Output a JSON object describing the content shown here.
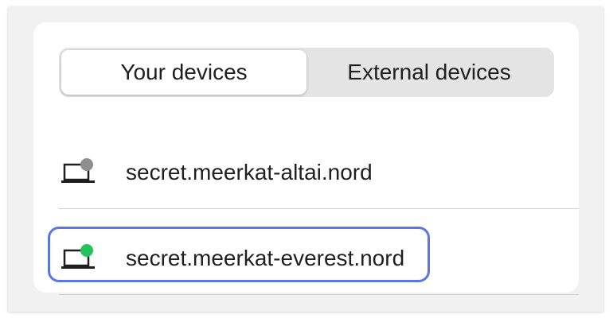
{
  "tabs": [
    {
      "label": "Your devices",
      "active": true
    },
    {
      "label": "External devices",
      "active": false
    }
  ],
  "devices": [
    {
      "name": "secret.meerkat-altai.nord",
      "icon": "laptop-icon",
      "status": "offline",
      "status_color": "#8e8e8e"
    },
    {
      "name": "secret.meerkat-everest.nord",
      "icon": "laptop-icon",
      "status": "online",
      "status_color": "#22c35d",
      "focused": true
    }
  ],
  "colors": {
    "focus_ring": "#5b74e8",
    "segment_bg": "#e4e4e4",
    "text": "#1f1f1f"
  }
}
